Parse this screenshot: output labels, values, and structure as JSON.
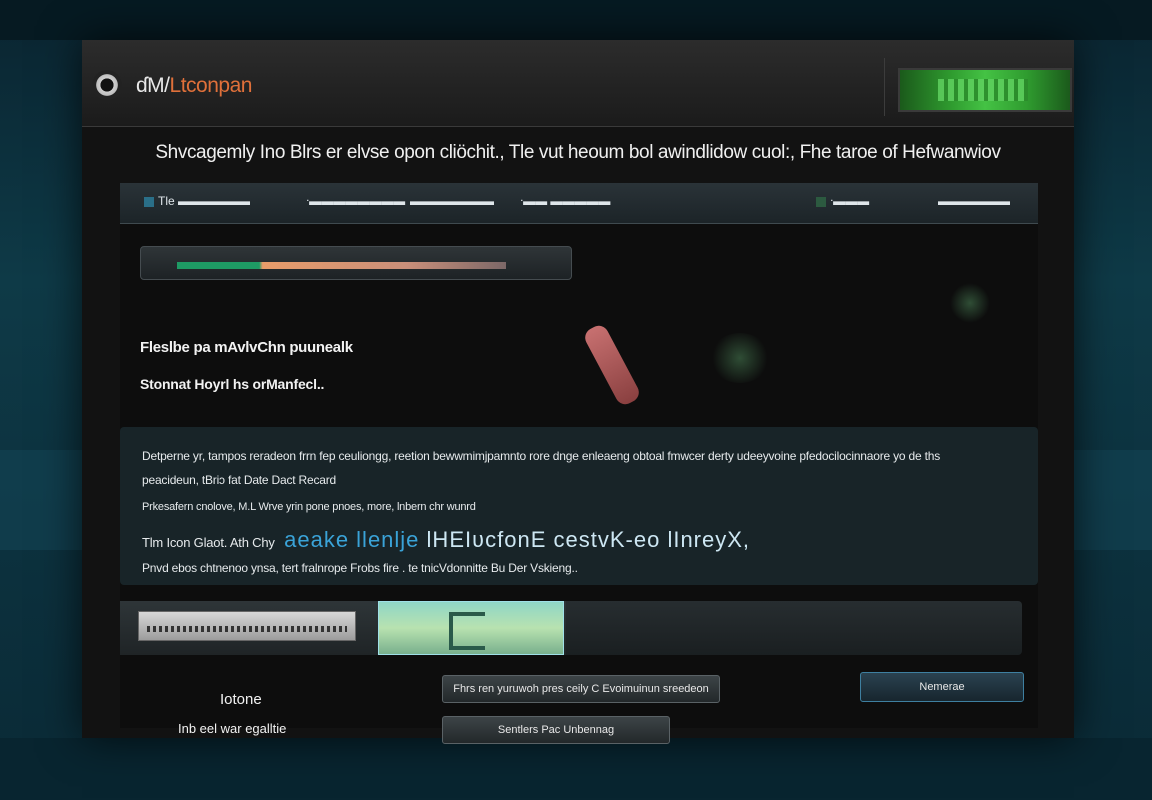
{
  "window": {
    "app_title_main": "ɗM/",
    "app_title_accent": "Ltconpan"
  },
  "banner": {
    "text": "Shvcagemly Ino Blrs er elvse opon cliöchit., Tle vut heoum bol awindlidow cuol:, Fhe taroe of Hefwanwiov"
  },
  "menubar": {
    "items": [
      {
        "label": "Tle ▬▬▬▬▬▬"
      },
      {
        "label": "ᐧ▬▬▬▬▬▬▬▬"
      },
      {
        "label": "▬▬▬▬▬▬▬"
      },
      {
        "label": "ᐧ▬▬ ▬▬▬▬▬"
      },
      {
        "label": "ᐧ▬▬▬"
      },
      {
        "label": "▬▬▬▬▬▬"
      }
    ]
  },
  "progress": {
    "fraction": 0.92
  },
  "headings": {
    "primary": "Fleslbe pa mAvlvChn puunealk",
    "secondary": "Stonnat Hoyrl hs orManfecl.."
  },
  "info": {
    "line1": "Detperne yr, tampos reradeon frrn fep ceuliongg, reetion bewwmimjpamnto rore dnge enleaeng obtoal fmwcer derty udeeyvoine pfedocilocinnaore yo de ths",
    "line2": "peacideun, tBriɔ fat Date Dact Recard",
    "line3": "Prkesafern cnolove, M.L Wrve yrin pone pnoes, more, lnbern chr wunrd",
    "line4_prefix": "Tlm Icon Glaot. Ath Chy",
    "line4_blue": "aeake llenlje",
    "line4_glitch": "lHEIʋcfonE cestvK-eo lInreyX,",
    "line5": "Pnvd ebos chtnenoo ynsa, tert fralnrope Frobs fire . te tnicVdonnitte Bu Der Vskieng.."
  },
  "footer": {
    "title": "Iotone",
    "subtitle": "Inb eel war egalltie"
  },
  "buttons": {
    "primary_wide": "Fhrs ren yuruwoh pres ceily C Evoimuinun sreedeon",
    "secondary": "Sentlers Pac Unbennag",
    "small": "Nemerae"
  },
  "colors": {
    "accent_orange": "#e0703a",
    "status_green": "#44c244",
    "progress_green": "#1e9a64",
    "progress_peach": "#e89c6a",
    "link_blue": "#3aa3d8"
  }
}
